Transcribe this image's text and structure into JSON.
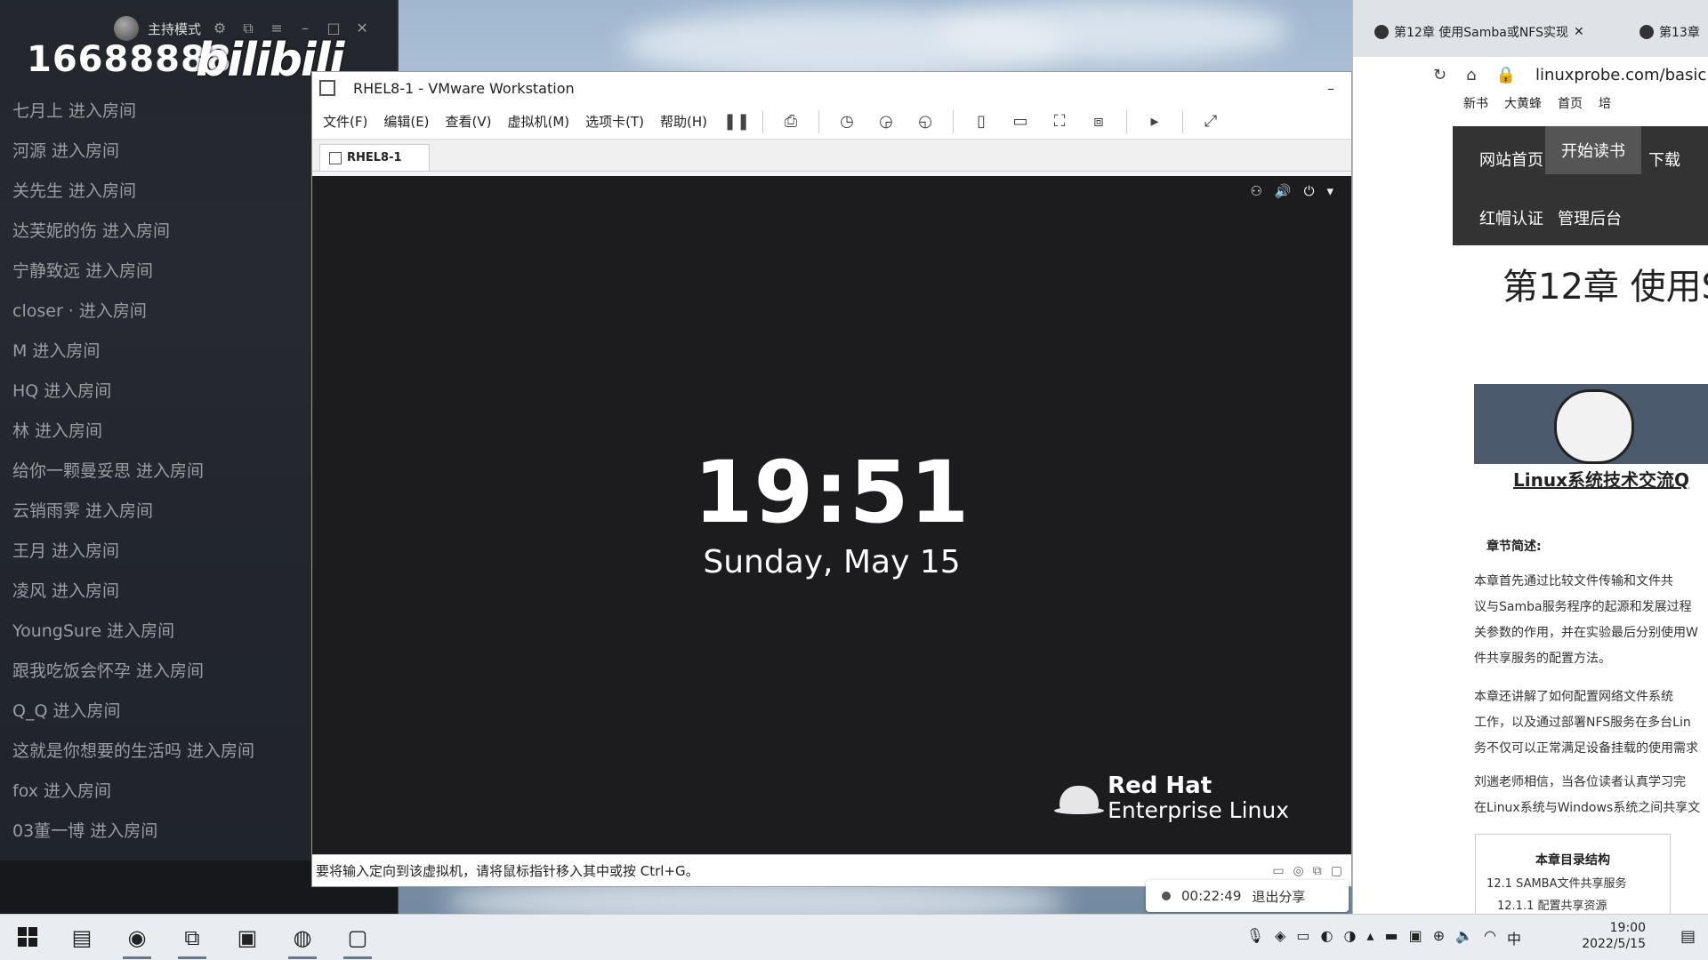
{
  "chat": {
    "host_mode": "主持模式",
    "room_id": "16688888",
    "brand": "bilibili",
    "entries": [
      "七月上 进入房间",
      "河源 进入房间",
      "关先生 进入房间",
      "达芙妮的伤 进入房间",
      "宁静致远 进入房间",
      "closer ·   进入房间",
      "M 进入房间",
      "HQ 进入房间",
      "林 进入房间",
      "给你一颗曼妥思 进入房间",
      "云销雨霁 进入房间",
      "王月 进入房间",
      "凌风 进入房间",
      "YoungSure 进入房间",
      "跟我吃饭会怀孕 进入房间",
      "Q_Q 进入房间",
      "这就是你想要的生活吗 进入房间",
      "fox 进入房间",
      "03董一博 进入房间"
    ]
  },
  "vmware": {
    "title": "RHEL8-1 - VMware Workstation",
    "menu": [
      "文件(F)",
      "编辑(E)",
      "查看(V)",
      "虚拟机(M)",
      "选项卡(T)",
      "帮助(H)"
    ],
    "tab": "RHEL8-1",
    "guest": {
      "time": "19:51",
      "date": "Sunday, May 15",
      "brand_line1": "Red Hat",
      "brand_line2": "Enterprise Linux"
    },
    "status_text": "要将输入定向到该虚拟机，请将鼠标指针移入其中或按 Ctrl+G。"
  },
  "share": {
    "timer": "00:22:49",
    "exit": "退出分享"
  },
  "browser": {
    "tab1": "第12章 使用Samba或NFS实现",
    "tab2": "第13章",
    "url": "linuxprobe.com/basic",
    "bookmarks": [
      "新书",
      "大黄蜂",
      "首页",
      "培"
    ],
    "site_nav": [
      "网站首页",
      "开始读书",
      "下载",
      "红帽认证",
      "管理后台"
    ],
    "page_heading": "第12章 使用S",
    "qq_link": "Linux系统技术交流Q",
    "section_title": "章节简述:",
    "paragraphs": [
      "本章首先通过比较文件传输和文件共",
      "议与Samba服务程序的起源和发展过程",
      "关参数的作用，并在实验最后分别使用W",
      "件共享服务的配置方法。",
      "本章还讲解了如何配置网络文件系统",
      "工作，以及通过部署NFS服务在多台Lin",
      "务不仅可以正常满足设备挂载的使用需求",
      "刘遄老师相信，当各位读者认真学习完",
      "在Linux系统与Windows系统之间共享文"
    ],
    "toc_title": "本章目录结构",
    "toc_items": [
      "12.1 SAMBA文件共享服务",
      "12.1.1 配置共享资源"
    ]
  },
  "taskbar": {
    "time": "19:00",
    "date": "2022/5/15",
    "ime": "中"
  }
}
